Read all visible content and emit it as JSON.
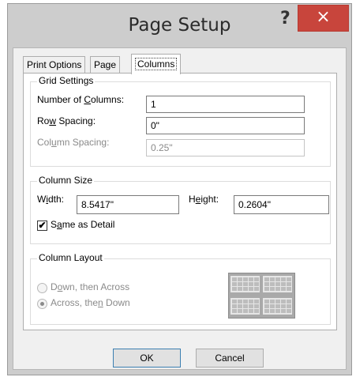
{
  "window": {
    "title": "Page Setup",
    "help_glyph": "?",
    "close_glyph": "×"
  },
  "tabs": [
    {
      "label": "Print Options"
    },
    {
      "label": "Page"
    },
    {
      "label": "Columns"
    }
  ],
  "grid_settings": {
    "legend": "Grid Settings",
    "number_of_columns": {
      "label_pre": "Number of ",
      "label_u": "C",
      "label_post": "olumns:",
      "value": "1"
    },
    "row_spacing": {
      "label_pre": "Ro",
      "label_u": "w",
      "label_post": " Spacing:",
      "value": "0\""
    },
    "column_spacing": {
      "label_pre": "Col",
      "label_u": "u",
      "label_post": "mn Spacing:",
      "value": "0.25\""
    }
  },
  "column_size": {
    "legend": "Column Size",
    "width": {
      "label_pre": "W",
      "label_u": "i",
      "label_post": "dth:",
      "value": "8.5417\""
    },
    "height": {
      "label_pre": "H",
      "label_u": "e",
      "label_post": "ight:",
      "value": "0.2604\""
    },
    "same_as_detail": {
      "check": "✔",
      "label_pre": "S",
      "label_u": "a",
      "label_post": "me as Detail",
      "checked": true
    }
  },
  "column_layout": {
    "legend": "Column Layout",
    "down_then_across": {
      "label_pre": "D",
      "label_u": "o",
      "label_post": "wn, then Across",
      "selected": false
    },
    "across_then_down": {
      "label_pre": "Across, the",
      "label_u": "n",
      "label_post": " Down",
      "selected": true
    },
    "preview_icon": "column-layout-preview"
  },
  "buttons": {
    "ok": "OK",
    "cancel": "Cancel"
  },
  "colors": {
    "close_button": "#c8453c",
    "dialog_frame": "#cdcdcd",
    "default_button_border": "#3c7fb1"
  }
}
